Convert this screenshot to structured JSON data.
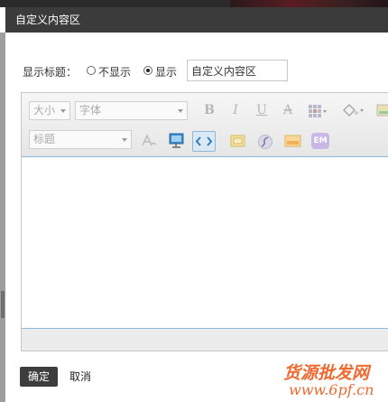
{
  "dialog": {
    "title": "自定义内容区",
    "show_title_label": "显示标题：",
    "radio_hide_label": "不显示",
    "radio_show_label": "显示",
    "radio_selected": "显示",
    "title_input_value": "自定义内容区"
  },
  "toolbar": {
    "font_size_select": "大小",
    "font_family_select": "字体",
    "format_select": "标题",
    "bold_label": "B",
    "italic_label": "I",
    "underline_label": "U",
    "strike_label": "A",
    "emoticon_label": "EM",
    "icons": [
      "bold-icon",
      "italic-icon",
      "underline-icon",
      "strikethrough-icon",
      "table-icon",
      "fill-color-icon",
      "image-icon",
      "clear-format-icon",
      "slideshow-icon",
      "source-code-icon",
      "insert-image-icon",
      "flash-icon",
      "gallery-icon",
      "emoticon-icon"
    ],
    "active_button": "source-code-icon",
    "accent_color": "#8fb7d8"
  },
  "editor": {
    "content": ""
  },
  "footer": {
    "ok_label": "确定",
    "cancel_label": "取消"
  },
  "watermark": {
    "line1": "货源批发网",
    "line2": "www.6pf.cn",
    "color": "#ee6a30"
  }
}
